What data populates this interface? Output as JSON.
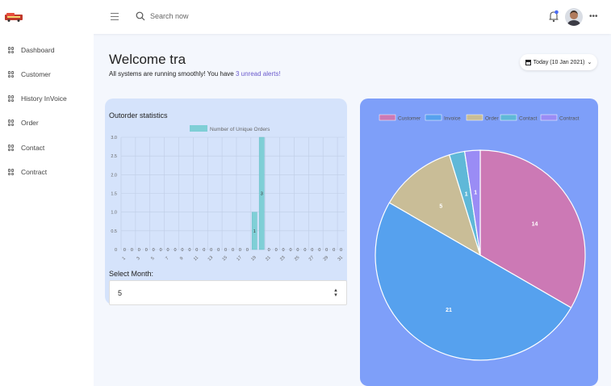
{
  "colors": {
    "customer": "#cc79b5",
    "invoice": "#56a1ee",
    "order": "#c9bd97",
    "contact": "#5fb8d8",
    "contract": "#9a8cf5",
    "bar": "#7fcfd6",
    "accent": "#6a5acd"
  },
  "header": {
    "search_placeholder": "Search now",
    "more_label": "•••"
  },
  "sidebar": {
    "items": [
      {
        "label": "Dashboard",
        "icon": "grid-icon"
      },
      {
        "label": "Customer",
        "icon": "grid-icon"
      },
      {
        "label": "History InVoice",
        "icon": "grid-icon"
      },
      {
        "label": "Order",
        "icon": "grid-icon"
      },
      {
        "label": "Contact",
        "icon": "grid-icon"
      },
      {
        "label": "Contract",
        "icon": "grid-icon"
      }
    ]
  },
  "main": {
    "welcome": "Welcome tra",
    "status_text": "All systems are running smoothly! You have ",
    "alert_link": "3 unread alerts!",
    "date_button": "Today (10 Jan 2021)",
    "select_month_label": "Select Month:",
    "select_month_value": "5"
  },
  "chart_data": [
    {
      "type": "bar",
      "title": "Outorder statistics",
      "legend": [
        "Number of Unique Orders"
      ],
      "legend_position": "top",
      "grid": true,
      "ylim": [
        0,
        3.0
      ],
      "yticks": [
        "3.0",
        "2.5",
        "2.0",
        "1.5",
        "1.0",
        "0.5",
        "0"
      ],
      "categories": [
        "1",
        "2",
        "3",
        "4",
        "5",
        "6",
        "7",
        "8",
        "9",
        "10",
        "11",
        "12",
        "13",
        "14",
        "15",
        "16",
        "17",
        "18",
        "19",
        "20",
        "21",
        "22",
        "23",
        "24",
        "25",
        "26",
        "27",
        "28",
        "29",
        "30",
        "31"
      ],
      "xtick_labels": [
        "1",
        "3",
        "5",
        "7",
        "9",
        "11",
        "13",
        "15",
        "17",
        "19",
        "21",
        "23",
        "25",
        "27",
        "29",
        "31"
      ],
      "series": [
        {
          "name": "Number of Unique Orders",
          "values": [
            0,
            0,
            0,
            0,
            0,
            0,
            0,
            0,
            0,
            0,
            0,
            0,
            0,
            0,
            0,
            0,
            0,
            0,
            1,
            3,
            0,
            0,
            0,
            0,
            0,
            0,
            0,
            0,
            0,
            0,
            0
          ]
        }
      ]
    },
    {
      "type": "pie",
      "legend": [
        "Customer",
        "Invoice",
        "Order",
        "Contact",
        "Contract"
      ],
      "legend_position": "top",
      "values": [
        14,
        21,
        5,
        1,
        1
      ]
    }
  ]
}
